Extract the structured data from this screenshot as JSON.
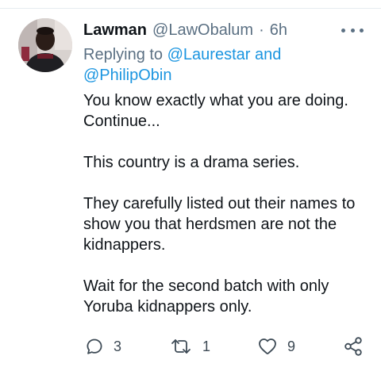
{
  "tweet": {
    "display_name": "Lawman",
    "handle": "@LawObalum",
    "separator": "·",
    "time": "6h",
    "replying_prefix": "Replying to",
    "mention_1": "@Laurestar",
    "mention_joiner": "and",
    "mention_2": "@PhilipObin",
    "body": [
      "You know exactly what you are doing. Continue...",
      "This country is a drama series.",
      "They carefully listed out their names to show you that herdsmen are not the kidnappers.",
      "Wait for the second batch with only Yoruba kidnappers only."
    ],
    "counts": {
      "replies": "3",
      "retweets": "1",
      "likes": "9"
    }
  },
  "icons": {
    "more": "more-horizontal-icon",
    "reply": "reply-bubble-icon",
    "retweet": "retweet-icon",
    "like": "heart-icon",
    "share": "share-icon"
  },
  "colors": {
    "link": "#1b95e0",
    "secondary": "#5b7083",
    "text": "#0f1419",
    "icon": "#3d4a55"
  }
}
